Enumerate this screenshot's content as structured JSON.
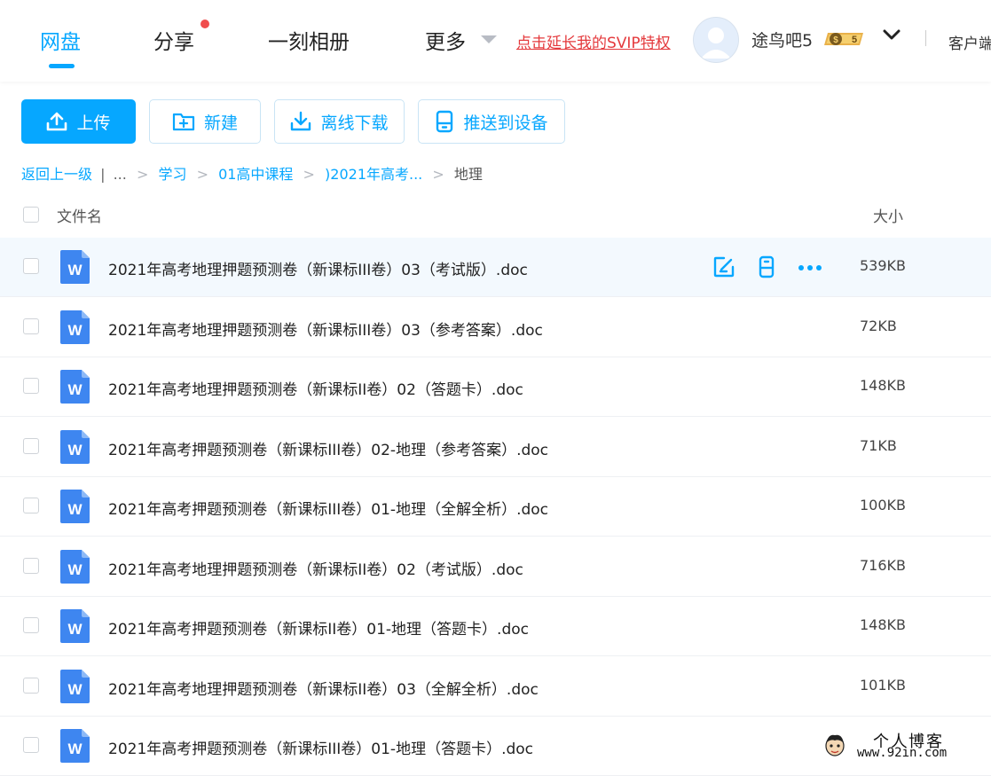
{
  "nav": {
    "tabs": [
      {
        "label": "网盘",
        "active": true
      },
      {
        "label": "分享",
        "has_dot": true
      },
      {
        "label": "一刻相册"
      },
      {
        "label": "更多"
      }
    ],
    "svip_link": "点击延长我的SVIP特权",
    "username": "途鸟吧5",
    "vip_level": "5",
    "client_label": "客户端"
  },
  "toolbar": {
    "upload": "上传",
    "new": "新建",
    "offline_download": "离线下载",
    "push_device": "推送到设备"
  },
  "breadcrumb": {
    "back": "返回上一级",
    "ellipsis": "...",
    "items": [
      "学习",
      "01高中课程",
      ")2021年高考..."
    ],
    "current": "地理"
  },
  "list": {
    "header_name": "文件名",
    "header_size": "大小",
    "rows": [
      {
        "name": "2021年高考地理押题预测卷（新课标III卷）03（考试版）.doc",
        "size": "539KB"
      },
      {
        "name": "2021年高考地理押题预测卷（新课标III卷）03（参考答案）.doc",
        "size": "72KB"
      },
      {
        "name": "2021年高考地理押题预测卷（新课标II卷）02（答题卡）.doc",
        "size": "148KB"
      },
      {
        "name": "2021年高考押题预测卷（新课标III卷）02-地理（参考答案）.doc",
        "size": "71KB"
      },
      {
        "name": "2021年高考押题预测卷（新课标III卷）01-地理（全解全析）.doc",
        "size": "100KB"
      },
      {
        "name": "2021年高考地理押题预测卷（新课标II卷）02（考试版）.doc",
        "size": "716KB"
      },
      {
        "name": "2021年高考押题预测卷（新课标II卷）01-地理（答题卡）.doc",
        "size": "148KB"
      },
      {
        "name": "2021年高考地理押题预测卷（新课标II卷）03（全解全析）.doc",
        "size": "101KB"
      },
      {
        "name": "2021年高考押题预测卷（新课标III卷）01-地理（答题卡）.doc",
        "size": ""
      }
    ]
  },
  "watermark": {
    "title": "个人博客",
    "url": "www.92in.com"
  }
}
